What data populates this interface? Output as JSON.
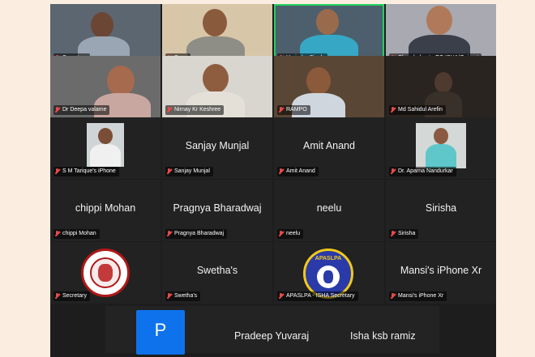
{
  "tiles": {
    "t1": {
      "label": "Secretary"
    },
    "t2": {
      "label": "Suraj"
    },
    "t3": {
      "label": "Harinder Singh"
    },
    "t4": {
      "label": "Chandrakant - EC ISHA/Gujarat"
    },
    "t5": {
      "label": "Dr Deepa valame"
    },
    "t6": {
      "label": "Nirnay Kr Keshree"
    },
    "t7": {
      "label": "RAMPO"
    },
    "t8": {
      "label": "Md Sahidul Arefin"
    },
    "t9": {
      "label": "S M Tarique's iPhone"
    },
    "t10": {
      "name": "Sanjay Munjal",
      "label": "Sanjay Munjal"
    },
    "t11": {
      "name": "Amit Anand",
      "label": "Amit Anand"
    },
    "t12": {
      "label": "Dr. Aparna Nandurkar"
    },
    "t13": {
      "name": "chippi Mohan",
      "label": "chippi Mohan"
    },
    "t14": {
      "name": "Pragnya Bharadwaj",
      "label": "Pragnya Bharadwaj"
    },
    "t15": {
      "name": "neelu",
      "label": "neelu"
    },
    "t16": {
      "name": "Sirisha",
      "label": "Sirisha"
    },
    "t17": {
      "label": "Secretary"
    },
    "t18": {
      "name": "Swetha's",
      "label": "Swetha's"
    },
    "t19": {
      "label": "APASLPA - ISHA Secretary",
      "logo_text": "APASLPA"
    },
    "t20": {
      "name": "Mansi's iPhone Xr",
      "label": "Mansi's iPhone Xr"
    }
  },
  "bottom": {
    "avatar_letter": "P",
    "name1": "Pradeep Yuvaraj",
    "name2": "Isha ksb ramiz"
  },
  "colors": {
    "background": "#fbeee0",
    "grid": "#1d1d1d",
    "active_speaker": "#23d160",
    "mic_muted": "#e84a4a",
    "avatar": "#0e72ed"
  }
}
